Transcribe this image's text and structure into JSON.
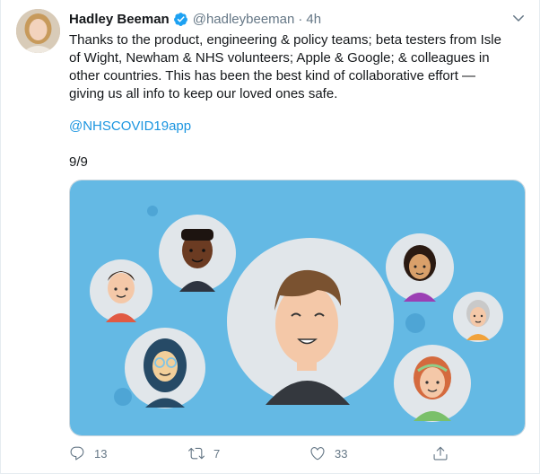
{
  "tweet": {
    "display_name": "Hadley Beeman",
    "handle": "@hadleybeeman",
    "separator": "·",
    "time": "4h",
    "body_lines": [
      "Thanks to the product, engineering & policy teams; beta testers from Isle",
      "of Wight, Newham & NHS volunteers; Apple & Google; & colleagues in",
      "other countries. This has been the best kind of collaborative effort —",
      "giving us all info to keep our loved ones safe."
    ],
    "mention": "@NHSCOVID19app",
    "thread_count": "9/9"
  },
  "media": {
    "background_color": "#64b9e4"
  },
  "actions": {
    "reply_count": "13",
    "retweet_count": "7",
    "like_count": "33"
  },
  "colors": {
    "verified": "#1da1f2",
    "link": "#1b95e0",
    "secondary": "#657786"
  },
  "icons": [
    "verified-badge-icon",
    "caret-down-icon",
    "reply-icon",
    "retweet-icon",
    "like-icon",
    "share-icon"
  ]
}
